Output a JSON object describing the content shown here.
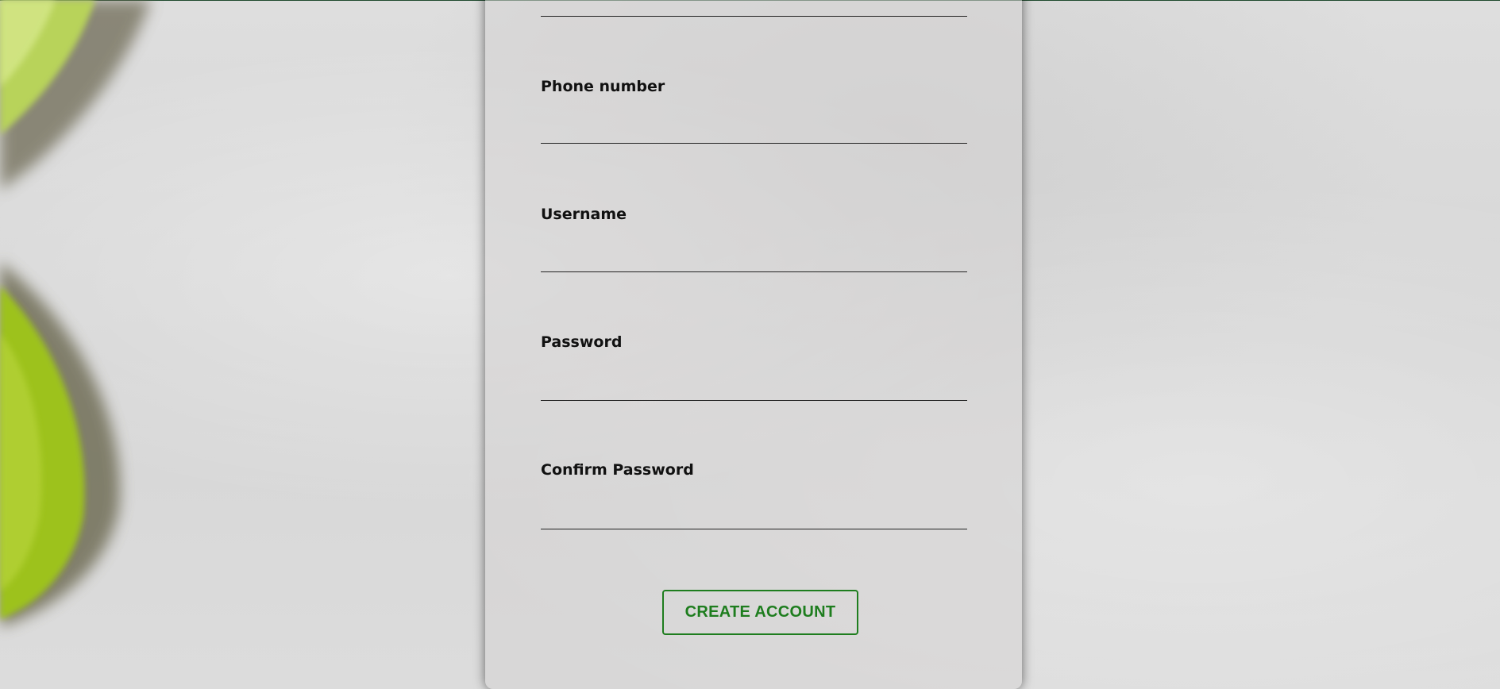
{
  "form": {
    "fields": [
      {
        "label": "Phone number",
        "value": ""
      },
      {
        "label": "Username",
        "value": ""
      },
      {
        "label": "Password",
        "value": ""
      },
      {
        "label": "Confirm Password",
        "value": ""
      }
    ],
    "submit_label": "CREATE ACCOUNT"
  },
  "colors": {
    "accent": "#1e7d1e",
    "label": "#111111",
    "leaf_green": "#9dc21a"
  }
}
